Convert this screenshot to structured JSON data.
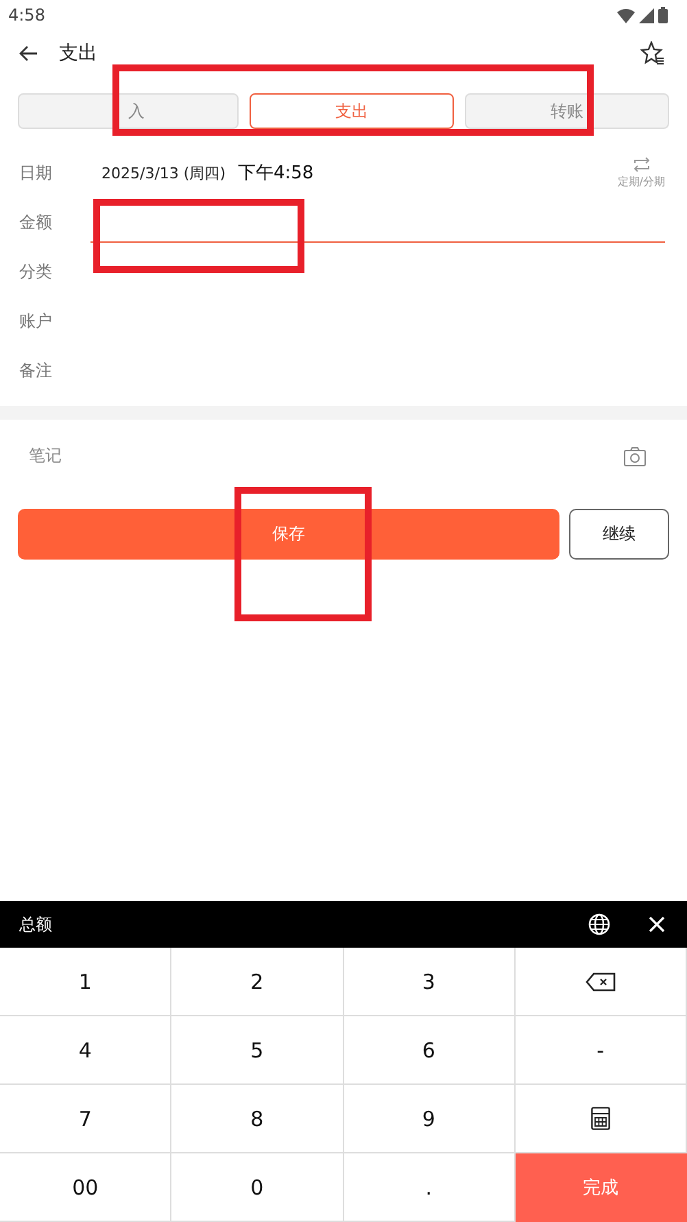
{
  "status_bar": {
    "time": "4:58"
  },
  "header": {
    "title": "支出"
  },
  "tabs": [
    {
      "label": "入",
      "selected": false
    },
    {
      "label": "支出",
      "selected": true
    },
    {
      "label": "转账",
      "selected": false
    }
  ],
  "form": {
    "date_label": "日期",
    "date": "2025/3/13 (周四)",
    "time": "下午4:58",
    "recurring_label": "定期/分期",
    "rows": [
      {
        "kind": "amount",
        "label": "金额"
      },
      {
        "kind": "plain",
        "label": "分类"
      },
      {
        "kind": "plain",
        "label": "账户"
      },
      {
        "kind": "plain",
        "label": "备注"
      }
    ]
  },
  "notes": {
    "placeholder": "笔记"
  },
  "buttons": {
    "save": "保存",
    "continue": "继续"
  },
  "keyboard": {
    "title": "总额",
    "keys": [
      {
        "kind": "text",
        "label": "1"
      },
      {
        "kind": "text",
        "label": "2"
      },
      {
        "kind": "text",
        "label": "3"
      },
      {
        "kind": "backspace"
      },
      {
        "kind": "text",
        "label": "4"
      },
      {
        "kind": "text",
        "label": "5"
      },
      {
        "kind": "text",
        "label": "6"
      },
      {
        "kind": "text",
        "label": "-"
      },
      {
        "kind": "text",
        "label": "7"
      },
      {
        "kind": "text",
        "label": "8"
      },
      {
        "kind": "text",
        "label": "9"
      },
      {
        "kind": "calculator"
      },
      {
        "kind": "text",
        "label": "00"
      },
      {
        "kind": "text",
        "label": "0"
      },
      {
        "kind": "text",
        "label": "."
      },
      {
        "kind": "done",
        "label": "完成"
      }
    ]
  },
  "annotation_boxes": [
    {
      "kind": "tabs"
    },
    {
      "kind": "amount"
    },
    {
      "kind": "save"
    }
  ]
}
